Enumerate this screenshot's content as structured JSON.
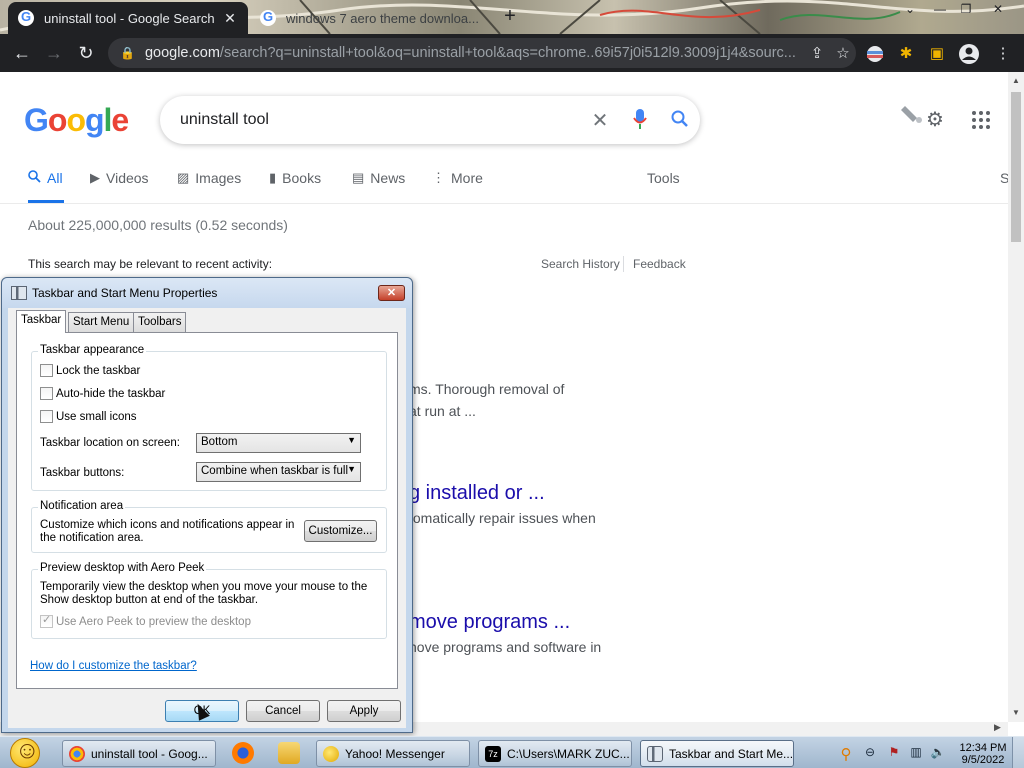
{
  "browser": {
    "tabs": [
      {
        "title": "uninstall tool - Google Search",
        "close": "✕"
      },
      {
        "title": "windows 7 aero theme downloa..."
      }
    ],
    "new_tab": "+",
    "url_host": "google.com",
    "url_rest": "/search?q=uninstall+tool&oq=uninstall+tool&aqs=chrome..69i57j0i512l9.3009j1j4&sourc..."
  },
  "google": {
    "logo_letters": [
      "G",
      "o",
      "o",
      "g",
      "l",
      "e"
    ],
    "logo_colors": [
      "#4285F4",
      "#EA4335",
      "#FBBC05",
      "#4285F4",
      "#34A853",
      "#EA4335"
    ],
    "query": "uninstall tool",
    "nav": [
      {
        "label": "All",
        "icon": "search-icon",
        "selected": true
      },
      {
        "label": "Videos",
        "icon": "video-icon"
      },
      {
        "label": "Images",
        "icon": "image-icon"
      },
      {
        "label": "Books",
        "icon": "book-icon"
      },
      {
        "label": "News",
        "icon": "news-icon"
      },
      {
        "label": "More",
        "icon": "more-vert-icon"
      }
    ],
    "tools": "Tools",
    "right_edge_letter": "S",
    "stats": "About 225,000,000 results (0.52 seconds)",
    "recent_activity": "This search may be relevant to recent activity:",
    "search_history": "Search History",
    "feedback": "Feedback",
    "visible_fragments": [
      "ms. Thorough removal of",
      "at run at ...",
      "g installed or ...",
      "tomatically repair issues when",
      "move programs ...",
      "nove programs and software in"
    ],
    "accent": "#1a73e8",
    "link_color": "#1a0dab"
  },
  "dialog": {
    "title": "Taskbar and Start Menu Properties",
    "close": "✕",
    "tabs": [
      "Taskbar",
      "Start Menu",
      "Toolbars"
    ],
    "appearance": {
      "heading": "Taskbar appearance",
      "lock": "Lock the taskbar",
      "autohide": "Auto-hide the taskbar",
      "small_icons": "Use small icons",
      "location_label": "Taskbar location on screen:",
      "location_value": "Bottom",
      "buttons_label": "Taskbar buttons:",
      "buttons_value": "Combine when taskbar is full"
    },
    "notification": {
      "heading": "Notification area",
      "text": "Customize which icons and notifications appear in the notification area.",
      "button": "Customize..."
    },
    "peek": {
      "heading": "Preview desktop with Aero Peek",
      "text": "Temporarily view the desktop when you move your mouse to the Show desktop button at end of the taskbar.",
      "checkbox": "Use Aero Peek to preview the desktop"
    },
    "help_link": "How do I customize the taskbar?",
    "buttons": {
      "ok": "OK",
      "cancel": "Cancel",
      "apply": "Apply"
    }
  },
  "taskbar": {
    "items": [
      "uninstall tool - Goog...",
      "Yahoo! Messenger",
      "C:\\Users\\MARK ZUC...",
      "Taskbar and Start Me..."
    ],
    "time": "12:34 PM",
    "date": "9/5/2022"
  }
}
